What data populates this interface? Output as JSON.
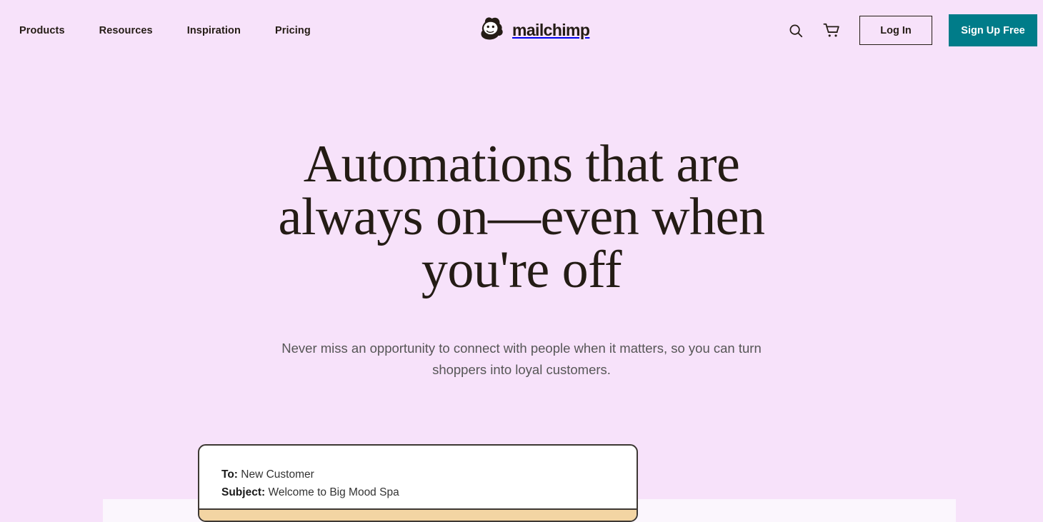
{
  "colors": {
    "page_background": "#F7E2FA",
    "ink": "#241C15",
    "teal_accent": "#007C89",
    "panel": "#FBF6FD",
    "card_band": "#F3D5A3"
  },
  "header": {
    "nav_items": [
      {
        "label": "Products"
      },
      {
        "label": "Resources"
      },
      {
        "label": "Inspiration"
      },
      {
        "label": "Pricing"
      }
    ],
    "logo": {
      "wordmark": "mailchimp",
      "mark_icon": "mailchimp-freddie-icon"
    },
    "search_icon": "search-icon",
    "cart_icon": "shopping-cart-icon",
    "login_label": "Log In",
    "signup_label": "Sign Up Free"
  },
  "hero": {
    "title": "Automations that are always on—even when you're off",
    "subtitle": "Never miss an opportunity to connect with people when it matters, so you can turn shoppers into loyal customers."
  },
  "email_preview": {
    "to_label": "To:",
    "to_value": "New Customer",
    "subject_label": "Subject:",
    "subject_value": "Welcome to Big Mood Spa"
  }
}
